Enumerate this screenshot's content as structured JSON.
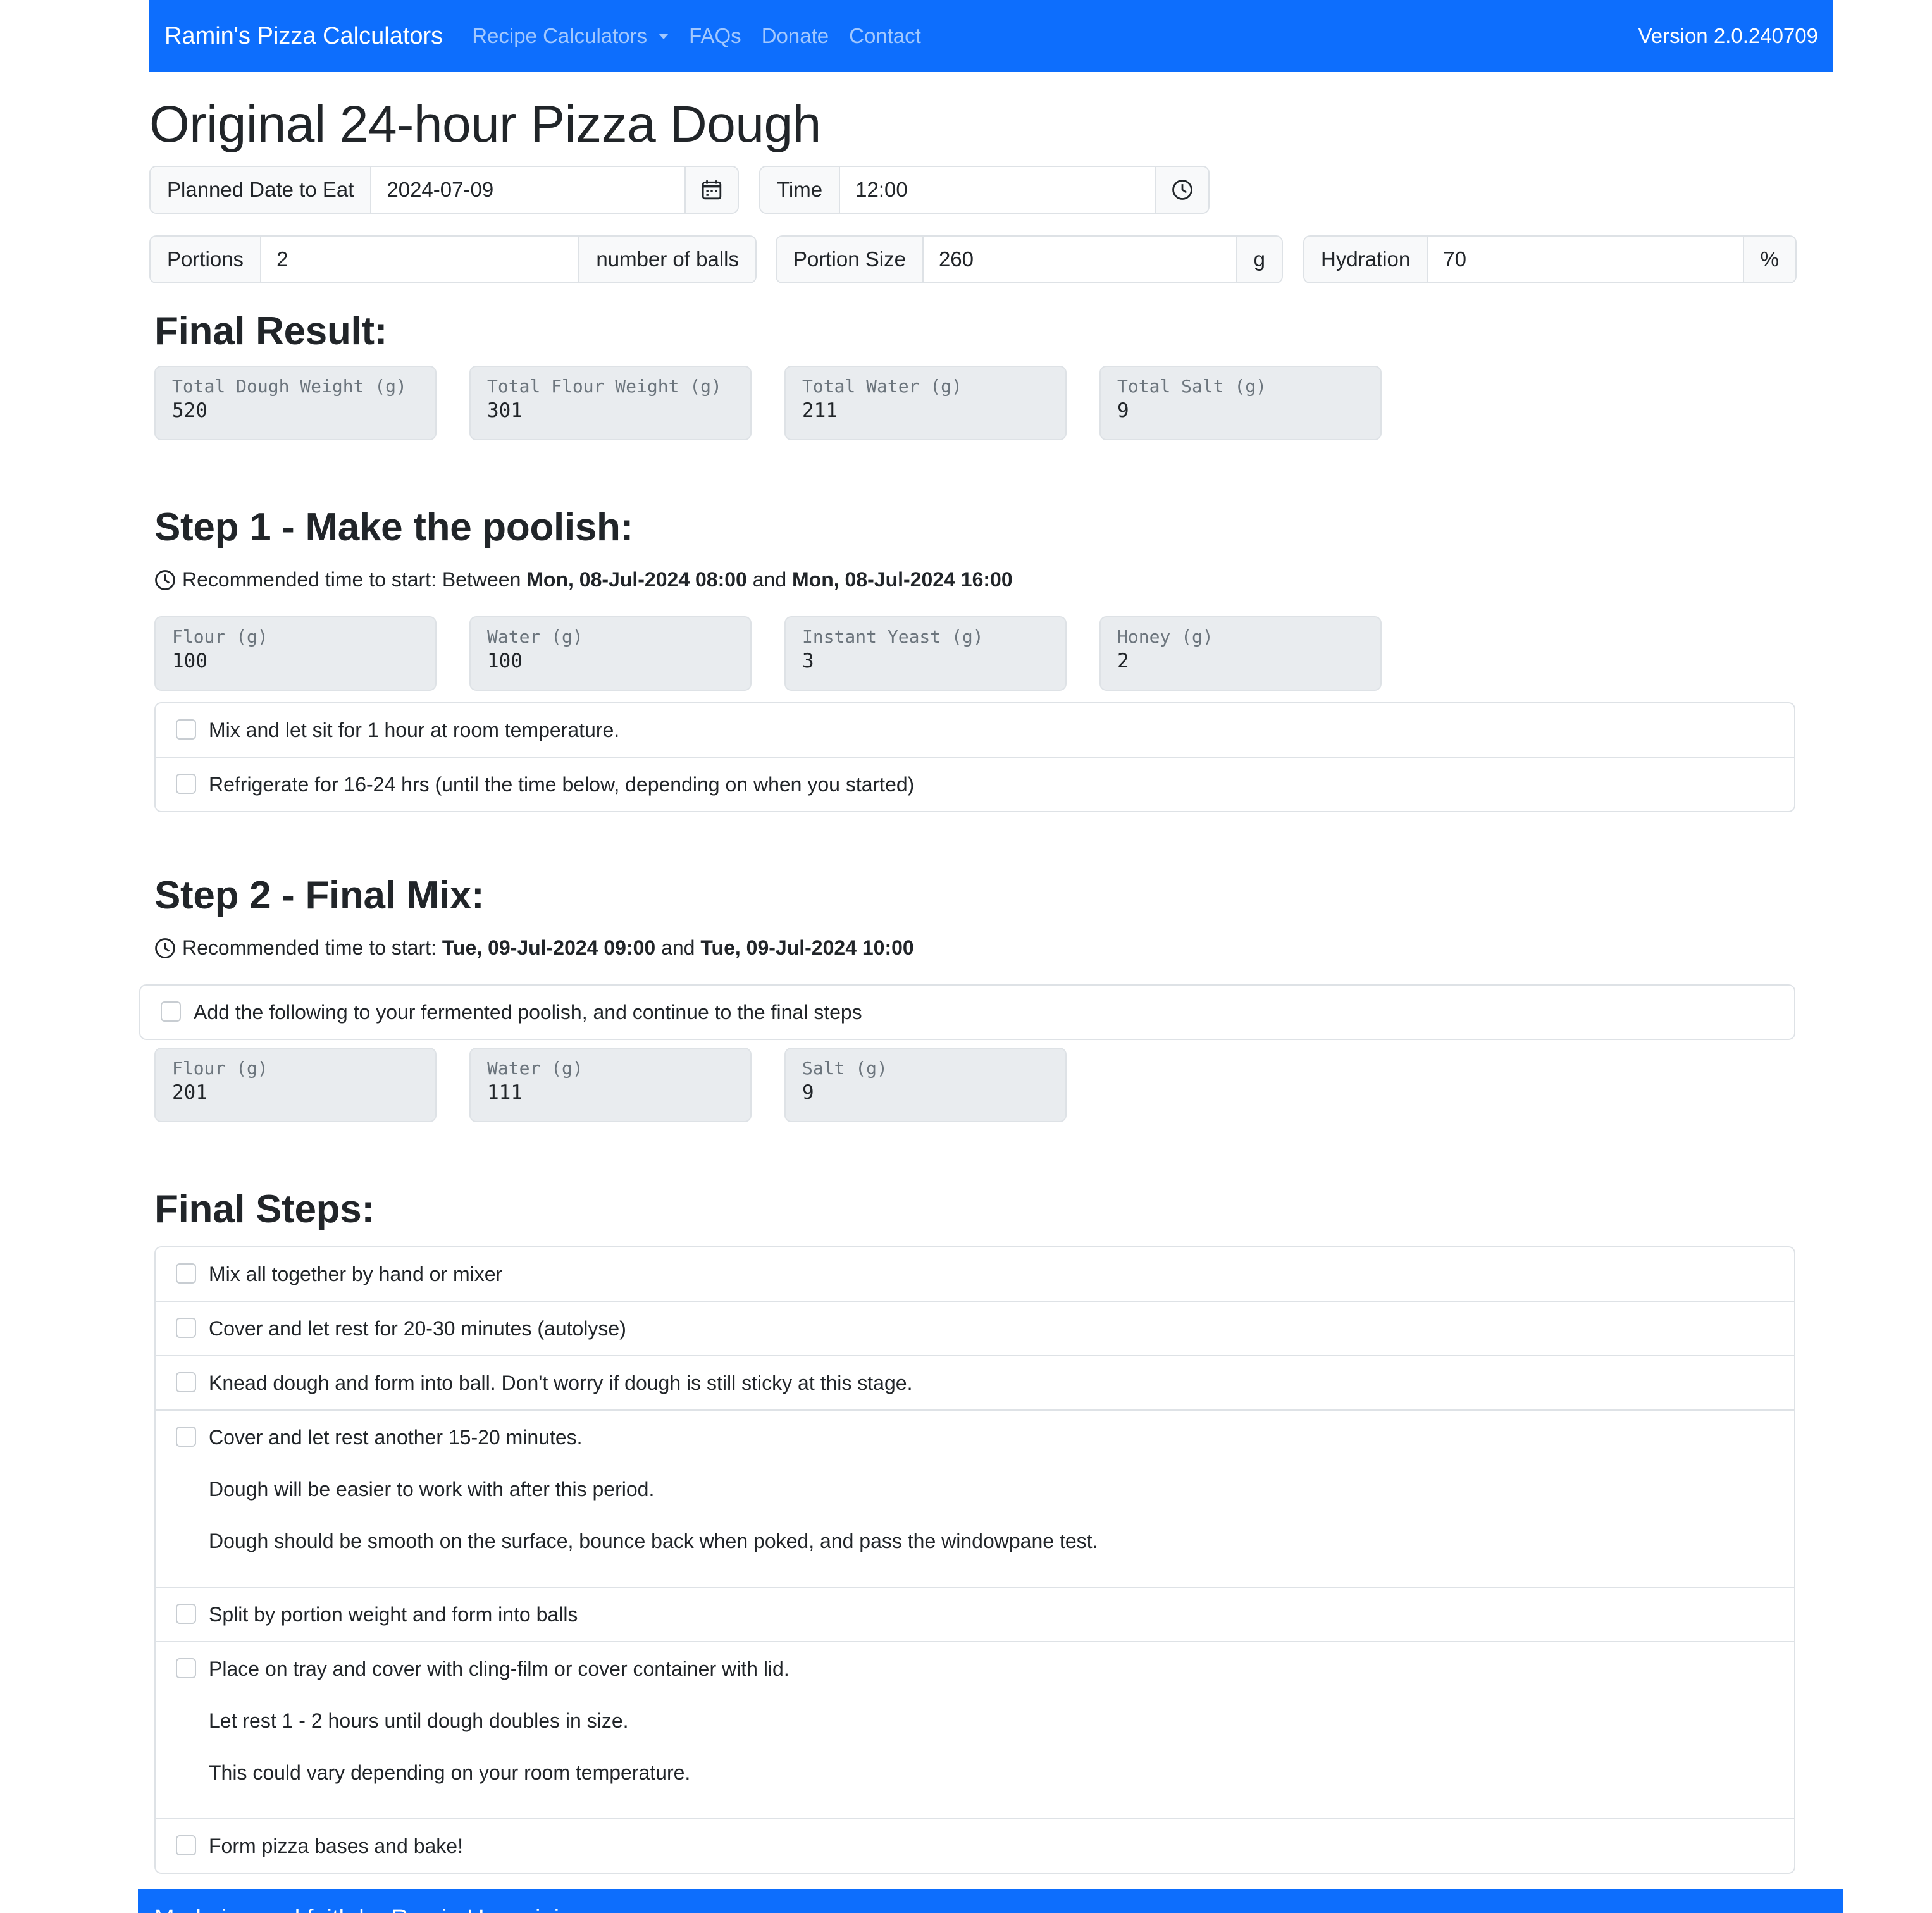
{
  "nav": {
    "brand": "Ramin's Pizza Calculators",
    "items": [
      "Recipe Calculators",
      "FAQs",
      "Donate",
      "Contact"
    ],
    "version": "Version 2.0.240709"
  },
  "page_title": "Original 24-hour Pizza Dough",
  "inputs": {
    "date_label": "Planned Date to Eat",
    "date_value": "2024-07-09",
    "time_label": "Time",
    "time_value": "12:00",
    "portions_label": "Portions",
    "portions_value": "2",
    "portions_unit": "number of balls",
    "portion_size_label": "Portion Size",
    "portion_size_value": "260",
    "portion_size_unit": "g",
    "hydration_label": "Hydration",
    "hydration_value": "70",
    "hydration_unit": "%"
  },
  "final_result": {
    "heading": "Final Result:",
    "boxes": [
      {
        "label": "Total Dough Weight (g)",
        "value": "520"
      },
      {
        "label": "Total Flour Weight (g)",
        "value": "301"
      },
      {
        "label": "Total Water (g)",
        "value": "211"
      },
      {
        "label": "Total Salt (g)",
        "value": "9"
      }
    ]
  },
  "step1": {
    "heading": "Step 1 - Make the poolish:",
    "rec_prefix": "Recommended time to start: Between",
    "rec_start": "Mon, 08-Jul-2024 08:00",
    "rec_and": "and",
    "rec_end": "Mon, 08-Jul-2024 16:00",
    "boxes": [
      {
        "label": "Flour (g)",
        "value": "100"
      },
      {
        "label": "Water (g)",
        "value": "100"
      },
      {
        "label": "Instant Yeast (g)",
        "value": "3"
      },
      {
        "label": "Honey (g)",
        "value": "2"
      }
    ],
    "checklist": [
      "Mix and let sit for 1 hour at room temperature.",
      "Refrigerate for 16-24 hrs (until the time below, depending on when you started)"
    ]
  },
  "step2": {
    "heading": "Step 2 - Final Mix:",
    "rec_prefix": "Recommended time to start:",
    "rec_start": "Tue, 09-Jul-2024 09:00",
    "rec_and": "and",
    "rec_end": "Tue, 09-Jul-2024 10:00",
    "checklist": [
      "Add the following to your fermented poolish, and continue to the final steps"
    ],
    "boxes": [
      {
        "label": "Flour (g)",
        "value": "201"
      },
      {
        "label": "Water (g)",
        "value": "111"
      },
      {
        "label": "Salt (g)",
        "value": "9"
      }
    ]
  },
  "final_steps": {
    "heading": "Final Steps:",
    "items": [
      [
        "Mix all together by hand or mixer"
      ],
      [
        "Cover and let rest for 20-30 minutes (autolyse)"
      ],
      [
        "Knead dough and form into ball. Don't worry if dough is still sticky at this stage."
      ],
      [
        "Cover and let rest another 15-20 minutes.",
        "Dough will be easier to work with after this period.",
        "Dough should be smooth on the surface, bounce back when poked, and pass the windowpane test."
      ],
      [
        "Split by portion weight and form into balls"
      ],
      [
        "Place on tray and cover with cling-film or cover container with lid.",
        "Let rest 1 - 2 hours until dough doubles in size.",
        "This could vary depending on your room temperature."
      ],
      [
        "Form pizza bases and bake!"
      ]
    ]
  },
  "footer": "Made in good faith by Ramin Hossaini",
  "colors": {
    "primary": "#0d6efd",
    "box_bg": "#e9ecef",
    "border": "#dee2e6",
    "text": "#212529"
  }
}
